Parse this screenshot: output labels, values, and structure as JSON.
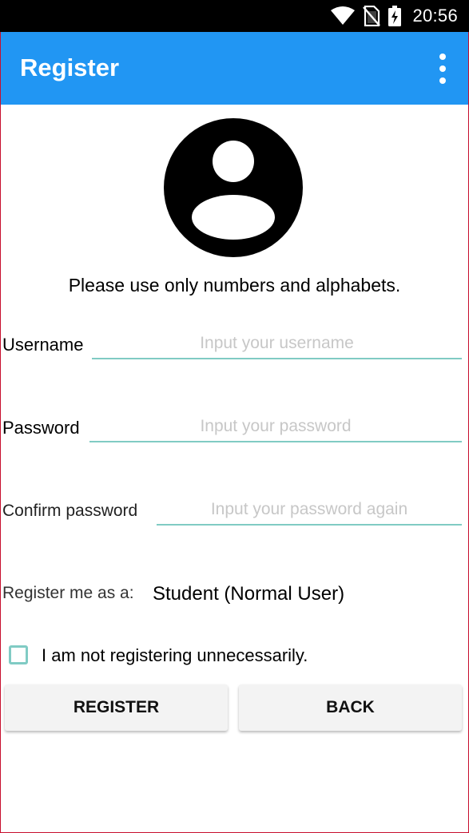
{
  "status_bar": {
    "time": "20:56",
    "icons": [
      "wifi-icon",
      "no-sim-icon",
      "battery-charging-icon"
    ]
  },
  "app_bar": {
    "title": "Register",
    "menu_icon": "more-vert-icon",
    "color": "#2196f3"
  },
  "avatar": {
    "icon": "account-circle-icon"
  },
  "hint": "Please use only numbers and alphabets.",
  "form": {
    "username": {
      "label": "Username",
      "value": "",
      "placeholder": "Input your username"
    },
    "password": {
      "label": "Password",
      "value": "",
      "placeholder": "Input your password"
    },
    "confirm_password": {
      "label": "Confirm password",
      "value": "",
      "placeholder": "Input your password again"
    },
    "role": {
      "label": "Register me as a:",
      "selected": "Student (Normal User)"
    },
    "agreement": {
      "label": "I am not registering unnecessarily.",
      "checked": false
    },
    "accent_color": "#80cbc4"
  },
  "buttons": {
    "register": "REGISTER",
    "back": "BACK"
  }
}
